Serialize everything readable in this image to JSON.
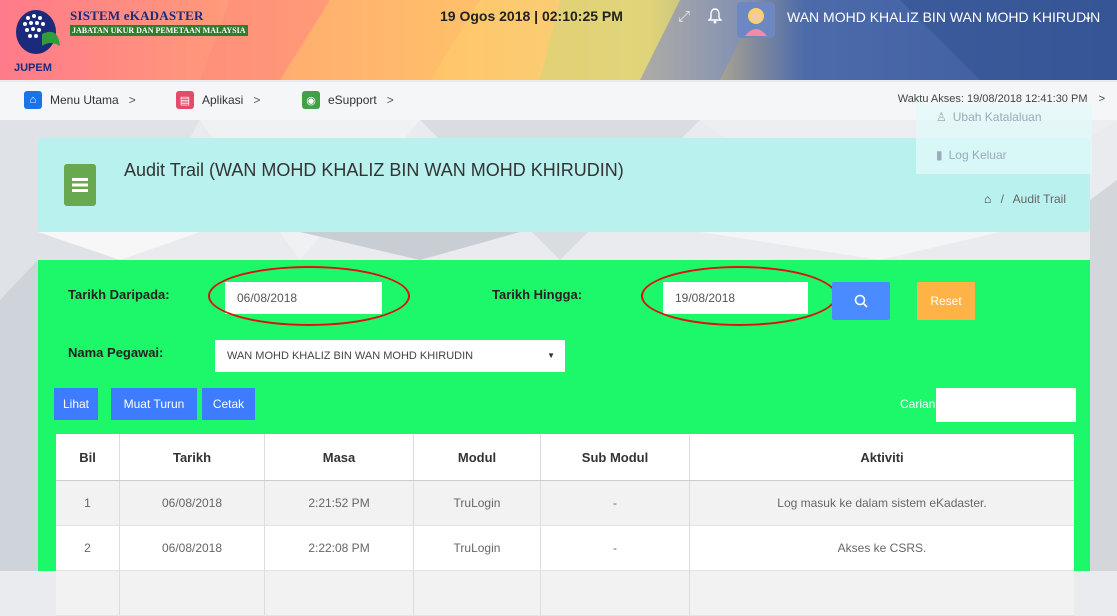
{
  "header": {
    "app_title": "SISTEM eKADASTER",
    "app_subtitle": "JABATAN UKUR DAN PEMETAAN MALAYSIA",
    "brand": "JUPEM",
    "datetime": "19 Ogos 2018 | 02:10:25 PM",
    "user_name": "WAN MOHD KHALIZ BIN WAN MOHD KHIRUDIN"
  },
  "menu": {
    "items": [
      {
        "label": "Menu Utama",
        "icon": "home-icon",
        "color": "#1a73e8"
      },
      {
        "label": "Aplikasi",
        "icon": "app-icon",
        "color": "#e64a6a"
      },
      {
        "label": "eSupport",
        "icon": "support-icon",
        "color": "#43a047"
      }
    ],
    "access_time": "Waktu Akses: 19/08/2018 12:41:30 PM"
  },
  "dropdown": {
    "change_password": "Ubah Katalaluan",
    "logout": "Log Keluar"
  },
  "page": {
    "title": "Audit Trail (WAN MOHD KHALIZ BIN WAN MOHD KHIRUDIN)",
    "breadcrumb_sep": "/",
    "breadcrumb_current": "Audit Trail"
  },
  "filter": {
    "from_label": "Tarikh Daripada:",
    "from_value": "06/08/2018",
    "to_label": "Tarikh Hingga:",
    "to_value": "19/08/2018",
    "officer_label": "Nama Pegawai:",
    "officer_value": "WAN MOHD KHALIZ BIN WAN MOHD KHIRUDIN",
    "reset_label": "Reset"
  },
  "table_tools": {
    "view": "Lihat",
    "download": "Muat Turun",
    "print": "Cetak",
    "search_label": "Carian:",
    "search_value": ""
  },
  "table": {
    "headers": [
      "Bil",
      "Tarikh",
      "Masa",
      "Modul",
      "Sub Modul",
      "Aktiviti"
    ],
    "rows": [
      [
        "1",
        "06/08/2018",
        "2:21:52 PM",
        "TruLogin",
        "-",
        "Log masuk ke dalam sistem eKadaster."
      ],
      [
        "2",
        "06/08/2018",
        "2:22:08 PM",
        "TruLogin",
        "-",
        "Akses ke CSRS."
      ]
    ]
  },
  "colors": {
    "filter_panel": "#1cf86a",
    "title_panel": "#b9f1ee",
    "primary_button": "#3d7cff",
    "reset_button": "#ffb347",
    "annotation": "#dd1111"
  }
}
